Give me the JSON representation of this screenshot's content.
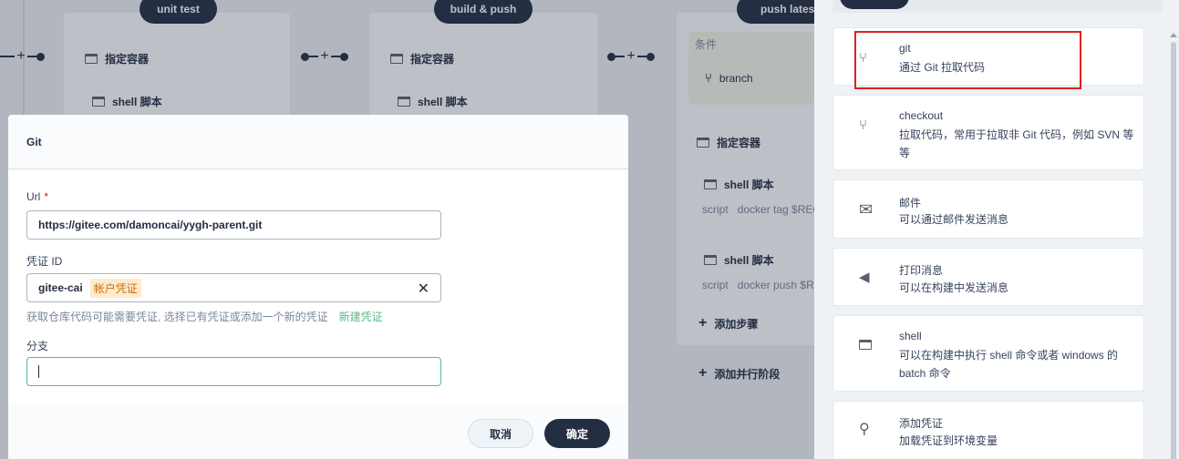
{
  "pipeline": {
    "stages": [
      {
        "name": "unit test",
        "steps": [
          "指定容器",
          "shell 脚本"
        ]
      },
      {
        "name": "build & push",
        "steps": [
          "指定容器",
          "shell 脚本"
        ]
      },
      {
        "name": "push lates",
        "condition_label": "条件",
        "condition_value": "branch",
        "steps": [
          "指定容器",
          "shell 脚本",
          "shell 脚本"
        ]
      }
    ],
    "script_label": "script",
    "script_lines": [
      "docker tag $REG",
      "docker push $RE"
    ],
    "add_step": "添加步骤",
    "add_parallel": "添加并行阶段"
  },
  "modal": {
    "title": "Git",
    "url_label": "Url",
    "url_required": "*",
    "url_value": "https://gitee.com/damoncai/yygh-parent.git",
    "cred_label": "凭证 ID",
    "cred_value": "gitee-cai",
    "cred_tag": "帐户凭证",
    "help_text": "获取仓库代码可能需要凭证, 选择已有凭证或添加一个新的凭证",
    "help_link": "新建凭证",
    "branch_label": "分支",
    "branch_value": "",
    "cancel": "取消",
    "ok": "确定"
  },
  "panel": {
    "items": [
      {
        "title": "git",
        "desc": "通过 Git 拉取代码",
        "icon": "branch-icon"
      },
      {
        "title": "checkout",
        "desc": "拉取代码，常用于拉取非 Git 代码，例如 SVN 等等",
        "icon": "branch-icon"
      },
      {
        "title": "邮件",
        "desc": "可以通过邮件发送消息",
        "icon": "mail-icon"
      },
      {
        "title": "打印消息",
        "desc": "可以在构建中发送消息",
        "icon": "megaphone-icon"
      },
      {
        "title": "shell",
        "desc": "可以在构建中执行 shell 命令或者 windows 的 batch 命令",
        "icon": "terminal-icon"
      },
      {
        "title": "添加凭证",
        "desc": "加载凭证到环境变量",
        "icon": "key-icon"
      }
    ]
  }
}
